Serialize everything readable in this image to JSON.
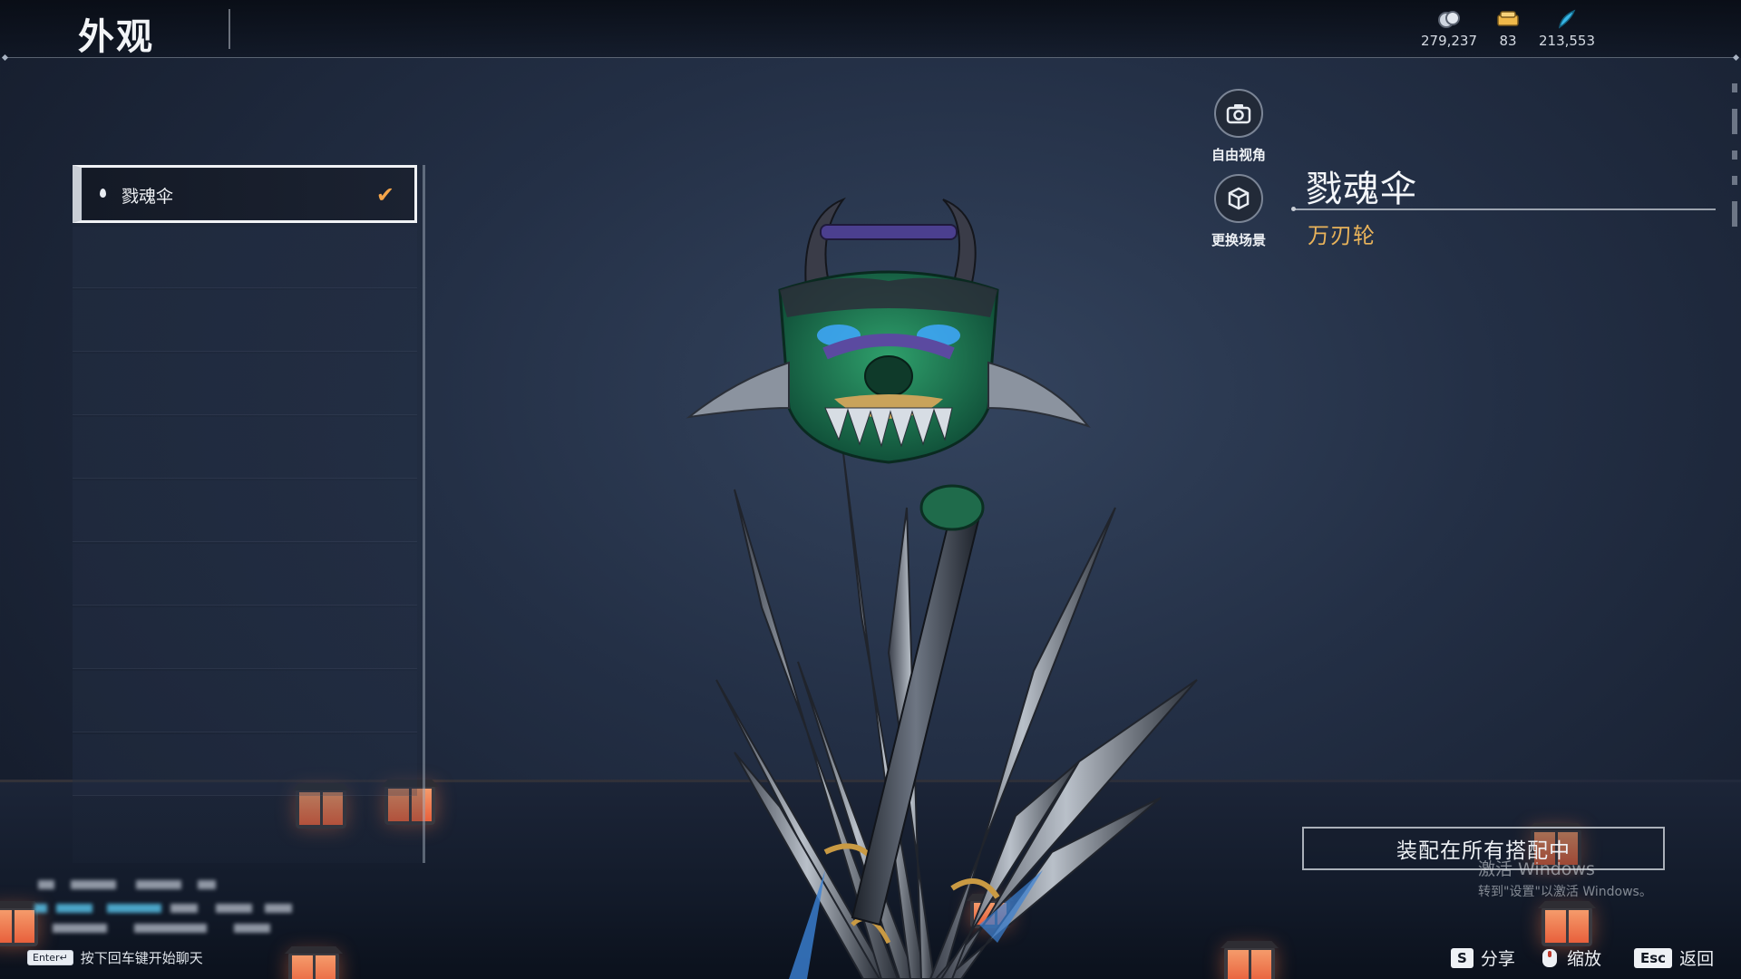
{
  "header": {
    "title": "外观"
  },
  "currencies": [
    {
      "icon": "coin-stack-icon",
      "value": "279,237",
      "color": "#cfd6e0"
    },
    {
      "icon": "ticket-icon",
      "value": "83",
      "color": "#f0b94a"
    },
    {
      "icon": "feather-icon",
      "value": "213,553",
      "color": "#38b7e8"
    }
  ],
  "list": {
    "items": [
      {
        "label": "戮魂伞",
        "selected": true
      }
    ]
  },
  "camera": {
    "free_view_label": "自由视角",
    "change_scene_label": "更换场景"
  },
  "item": {
    "name": "戮魂伞",
    "subtype": "万刃轮"
  },
  "equip_button": {
    "label": "装配在所有搭配中"
  },
  "watermark": {
    "line1": "激活 Windows",
    "line2": "转到\"设置\"以激活 Windows。"
  },
  "chat_hint": {
    "key": "Enter↵",
    "text": "按下回车键开始聊天"
  },
  "footer": {
    "share_key": "S",
    "share_label": "分享",
    "zoom_label": "缩放",
    "back_key": "Esc",
    "back_label": "返回"
  },
  "colors": {
    "accent": "#e9b35a",
    "check": "#f4a54a"
  }
}
